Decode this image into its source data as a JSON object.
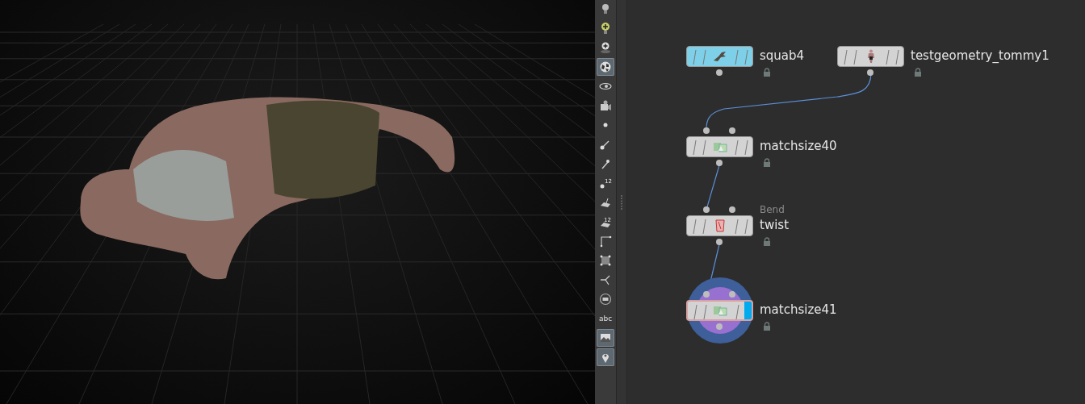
{
  "tools": [
    {
      "kind": "bulb",
      "selected": false
    },
    {
      "kind": "bulb-plus",
      "selected": false
    },
    {
      "kind": "bulb-ring",
      "selected": false
    },
    {
      "kind": "sphere",
      "selected": true
    },
    {
      "kind": "eye",
      "selected": false
    },
    {
      "kind": "camera",
      "selected": false
    },
    {
      "kind": "dot",
      "selected": false
    },
    {
      "kind": "stroke",
      "selected": false
    },
    {
      "kind": "pin",
      "selected": false
    },
    {
      "kind": "point-number",
      "label": "12",
      "selected": false
    },
    {
      "kind": "plane",
      "selected": false
    },
    {
      "kind": "plane-number",
      "label": "12",
      "selected": false
    },
    {
      "kind": "corner",
      "selected": false
    },
    {
      "kind": "box-points",
      "selected": false
    },
    {
      "kind": "branch",
      "selected": false
    },
    {
      "kind": "circle-bar",
      "selected": false
    },
    {
      "kind": "text",
      "label": "abc",
      "selected": false
    },
    {
      "kind": "image",
      "selected": true
    },
    {
      "kind": "marker",
      "selected": true
    }
  ],
  "network": {
    "nodes": [
      {
        "name": "squab4",
        "kind": "generator",
        "color": "#7ecfe8",
        "selected": false,
        "display_flag": false,
        "current": false
      },
      {
        "name": "testgeometry_tommy1",
        "kind": "generator",
        "color": "#d3d3d3",
        "selected": false,
        "display_flag": false,
        "current": false
      },
      {
        "name": "matchsize40",
        "kind": "two-input",
        "color": "#d3d3d3",
        "selected": false,
        "display_flag": false,
        "current": false
      },
      {
        "name": "twist",
        "subtitle": "Bend",
        "kind": "two-input",
        "color": "#d3d3d3",
        "selected": false,
        "display_flag": false,
        "current": false
      },
      {
        "name": "matchsize41",
        "kind": "two-input",
        "color": "#d3d3d3",
        "selected": true,
        "display_flag": true,
        "current": true
      }
    ]
  }
}
